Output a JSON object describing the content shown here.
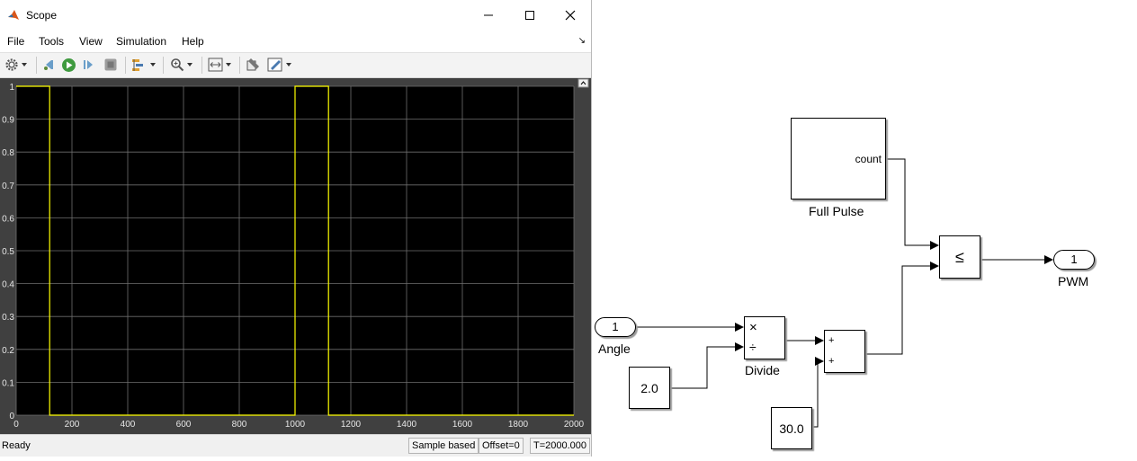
{
  "window": {
    "title": "Scope"
  },
  "menu": [
    "File",
    "Tools",
    "View",
    "Simulation",
    "Help"
  ],
  "toolbar_icons": [
    "gear-icon",
    "step-back-icon",
    "run-icon",
    "step-forward-icon",
    "stop-icon",
    "highlight-icon",
    "zoom-icon",
    "autoscale-icon",
    "configure-icon",
    "legend-icon"
  ],
  "status": {
    "ready": "Ready",
    "mode": "Sample based",
    "offset": "Offset=0",
    "time": "T=2000.000"
  },
  "colors": {
    "plot_bg": "#000000",
    "figure_bg": "#404040",
    "grid": "#6e6e6e",
    "signal": "#ffff00",
    "tick_text": "#e6e6e6"
  },
  "chart_data": {
    "type": "line",
    "title": "",
    "xlabel": "",
    "ylabel": "",
    "xlim": [
      0,
      2000
    ],
    "ylim": [
      0,
      1
    ],
    "xticks": [
      0,
      200,
      400,
      600,
      800,
      1000,
      1200,
      1400,
      1600,
      1800,
      2000
    ],
    "yticks": [
      0,
      0.1,
      0.2,
      0.3,
      0.4,
      0.5,
      0.6,
      0.7,
      0.8,
      0.9,
      1
    ],
    "ytick_labels": [
      "0",
      "0.1",
      "0.2",
      "0.3",
      "0.4",
      "0.5",
      "0.6",
      "0.7",
      "0.8",
      "0.9",
      "1"
    ],
    "grid": true,
    "series": [
      {
        "x": [
          0,
          120,
          120,
          1000,
          1000,
          1120,
          1120,
          2000
        ],
        "y": [
          1,
          1,
          0,
          0,
          1,
          1,
          0,
          0
        ]
      }
    ]
  },
  "diagram": {
    "blocks": {
      "full_pulse": {
        "label": "Full Pulse",
        "port": "count"
      },
      "compare": {
        "symbol": "≤"
      },
      "pwm": {
        "number": "1",
        "label": "PWM"
      },
      "angle": {
        "number": "1",
        "label": "Angle"
      },
      "divide": {
        "label": "Divide",
        "mul": "×",
        "div": "÷"
      },
      "sum": {
        "plus1": "+",
        "plus2": "+"
      },
      "const_2": {
        "value": "2.0"
      },
      "const_30": {
        "value": "30.0"
      }
    }
  }
}
